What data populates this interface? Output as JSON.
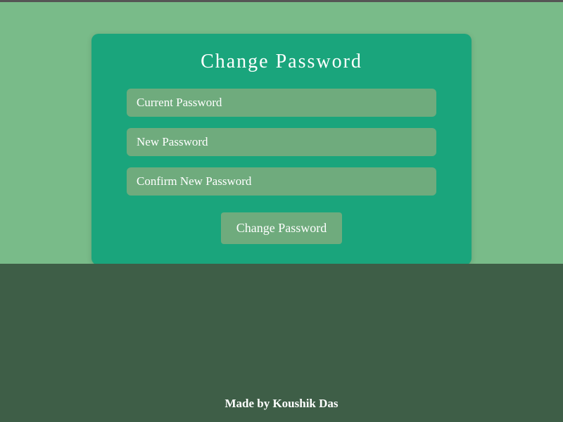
{
  "card": {
    "title": "Change Password",
    "fields": {
      "current": {
        "placeholder": "Current Password"
      },
      "new": {
        "placeholder": "New Password"
      },
      "confirm": {
        "placeholder": "Confirm New Password"
      }
    },
    "submit_label": "Change Password"
  },
  "footer": {
    "text": "Made by Koushik Das"
  }
}
